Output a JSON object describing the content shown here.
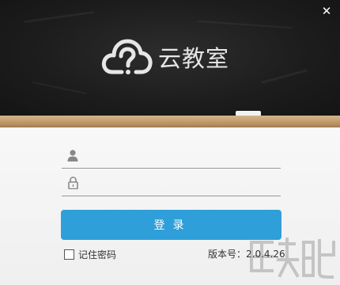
{
  "window": {
    "close_label": "✕"
  },
  "brand": {
    "name": "云教室",
    "logo_icon": "cloud-question-icon"
  },
  "login_form": {
    "username": {
      "icon": "user-icon",
      "value": "",
      "placeholder": ""
    },
    "password": {
      "icon": "lock-icon",
      "value": "",
      "placeholder": ""
    },
    "login_button_label": "登录",
    "remember_password_label": "记住密码",
    "remember_password_checked": false,
    "version_label": "版本号：",
    "version_value": "2.0.4.26"
  },
  "colors": {
    "chalkboard": "#1d1d1d",
    "ledge": "#c9a476",
    "accent": "#2f9fd9",
    "logo": "#e6e6e6"
  }
}
